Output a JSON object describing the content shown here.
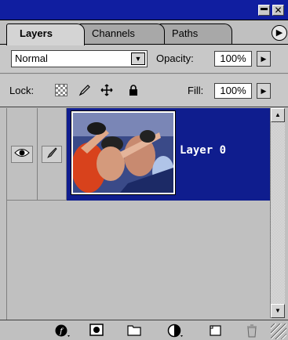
{
  "tabs": [
    {
      "label": "Layers",
      "active": true
    },
    {
      "label": "Channels",
      "active": false
    },
    {
      "label": "Paths",
      "active": false
    }
  ],
  "blend": {
    "mode": "Normal",
    "opacity_label": "Opacity:",
    "opacity_value": "100%"
  },
  "lock": {
    "label": "Lock:",
    "fill_label": "Fill:",
    "fill_value": "100%",
    "icons": [
      "lock-transparent-icon",
      "lock-paint-icon",
      "lock-move-icon",
      "lock-all-icon"
    ]
  },
  "layers": [
    {
      "name": "Layer 0",
      "visible": true,
      "selected": true
    }
  ],
  "footer_icons": [
    "layer-style-icon",
    "mask-icon",
    "new-set-icon",
    "adjustment-layer-icon",
    "new-layer-icon",
    "trash-icon"
  ],
  "colors": {
    "titlebar": "#101ea0",
    "selection": "#0f1d8e",
    "panel": "#c0c0c0"
  }
}
